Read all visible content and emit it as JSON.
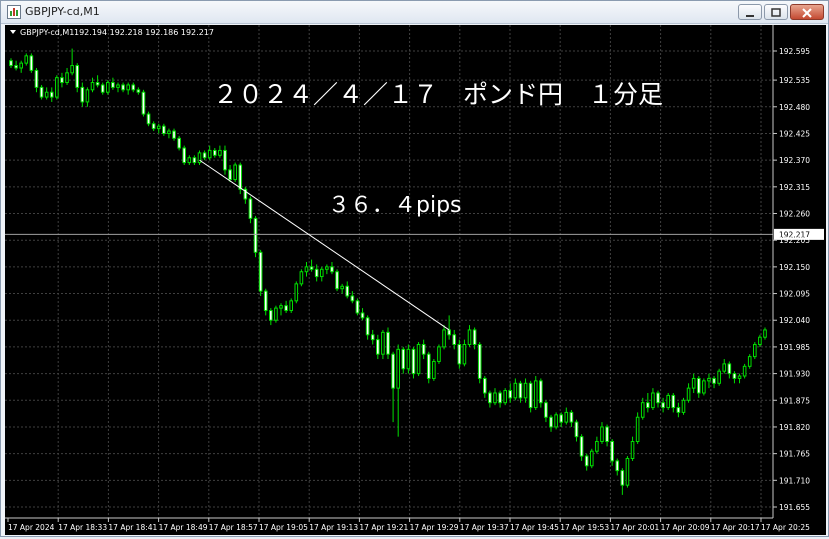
{
  "window": {
    "title": "GBPJPY-cd,M1",
    "buttons": [
      "minimize",
      "maximize",
      "close"
    ]
  },
  "chart_header": {
    "symbol": "GBPJPY-cd,M1",
    "ohlc": "192.194 192.218 192.186 192.217"
  },
  "annotations": {
    "title": "２０２４／４／１７　ポンド円　１分足",
    "pips": "３６．４pips"
  },
  "colors": {
    "background": "#000000",
    "grid": "#404040",
    "candle": "#00e000",
    "text": "#ffffff",
    "trendline": "#ffffff"
  },
  "chart_data": {
    "type": "candlestick",
    "symbol": "GBPJPY-cd",
    "timeframe": "M1",
    "y_ticks": [
      "192.595",
      "192.535",
      "192.480",
      "192.425",
      "192.370",
      "192.315",
      "192.260",
      "192.205",
      "192.150",
      "192.095",
      "192.040",
      "191.985",
      "191.930",
      "191.875",
      "191.820",
      "191.765",
      "191.710",
      "191.655"
    ],
    "x_ticks": [
      "17 Apr 2024",
      "17 Apr 18:33",
      "17 Apr 18:41",
      "17 Apr 18:49",
      "17 Apr 18:57",
      "17 Apr 19:05",
      "17 Apr 19:13",
      "17 Apr 19:21",
      "17 Apr 19:29",
      "17 Apr 19:37",
      "17 Apr 19:45",
      "17 Apr 19:53",
      "17 Apr 20:01",
      "17 Apr 20:09",
      "17 Apr 20:17",
      "17 Apr 20:25"
    ],
    "ylim": [
      191.64,
      192.64
    ],
    "current_price": "192.217",
    "trendline": {
      "from": [
        37,
        192.37
      ],
      "to": [
        86,
        192.02
      ]
    },
    "candles": [
      [
        192.575,
        192.58,
        192.56,
        192.565
      ],
      [
        192.565,
        192.575,
        192.555,
        192.56
      ],
      [
        192.56,
        192.575,
        192.55,
        192.57
      ],
      [
        192.57,
        192.59,
        192.565,
        192.585
      ],
      [
        192.585,
        192.59,
        192.55,
        192.555
      ],
      [
        192.555,
        192.56,
        192.51,
        192.52
      ],
      [
        192.52,
        192.525,
        192.495,
        192.5
      ],
      [
        192.5,
        192.52,
        192.495,
        192.51
      ],
      [
        192.51,
        192.52,
        192.49,
        192.5
      ],
      [
        192.5,
        192.545,
        192.495,
        192.54
      ],
      [
        192.54,
        192.55,
        192.52,
        192.53
      ],
      [
        192.53,
        192.56,
        192.525,
        192.55
      ],
      [
        192.55,
        192.6,
        192.545,
        192.565
      ],
      [
        192.565,
        192.57,
        192.51,
        192.52
      ],
      [
        192.52,
        192.53,
        192.48,
        192.49
      ],
      [
        192.49,
        192.52,
        192.48,
        192.515
      ],
      [
        192.515,
        192.54,
        192.51,
        192.53
      ],
      [
        192.53,
        192.545,
        192.52,
        192.525
      ],
      [
        192.525,
        192.53,
        192.505,
        192.51
      ],
      [
        192.51,
        192.535,
        192.505,
        192.53
      ],
      [
        192.53,
        192.54,
        192.515,
        192.52
      ],
      [
        192.52,
        192.53,
        192.51,
        192.525
      ],
      [
        192.525,
        192.53,
        192.51,
        192.515
      ],
      [
        192.515,
        192.53,
        192.505,
        192.525
      ],
      [
        192.525,
        192.53,
        192.51,
        192.515
      ],
      [
        192.515,
        192.52,
        192.505,
        192.51
      ],
      [
        192.51,
        192.515,
        192.46,
        192.465
      ],
      [
        192.465,
        192.47,
        192.44,
        192.445
      ],
      [
        192.445,
        192.45,
        192.43,
        192.435
      ],
      [
        192.435,
        192.445,
        192.425,
        192.44
      ],
      [
        192.44,
        192.445,
        192.42,
        192.425
      ],
      [
        192.425,
        192.435,
        192.415,
        192.43
      ],
      [
        192.43,
        192.435,
        192.41,
        192.415
      ],
      [
        192.415,
        192.42,
        192.39,
        192.395
      ],
      [
        192.395,
        192.4,
        192.36,
        192.365
      ],
      [
        192.365,
        192.38,
        192.36,
        192.375
      ],
      [
        192.375,
        192.38,
        192.36,
        192.365
      ],
      [
        192.365,
        192.39,
        192.36,
        192.385
      ],
      [
        192.385,
        192.39,
        192.37,
        192.375
      ],
      [
        192.375,
        192.4,
        192.37,
        192.39
      ],
      [
        192.39,
        192.395,
        192.375,
        192.38
      ],
      [
        192.38,
        192.4,
        192.375,
        192.39
      ],
      [
        192.39,
        192.4,
        192.34,
        192.35
      ],
      [
        192.35,
        192.36,
        192.325,
        192.33
      ],
      [
        192.33,
        192.365,
        192.325,
        192.36
      ],
      [
        192.36,
        192.365,
        192.3,
        192.31
      ],
      [
        192.31,
        192.315,
        192.28,
        192.29
      ],
      [
        192.29,
        192.295,
        192.24,
        192.25
      ],
      [
        192.25,
        192.255,
        192.17,
        192.18
      ],
      [
        192.18,
        192.185,
        192.09,
        192.1
      ],
      [
        192.1,
        192.105,
        192.05,
        192.06
      ],
      [
        192.06,
        192.065,
        192.03,
        192.04
      ],
      [
        192.04,
        192.07,
        192.035,
        192.065
      ],
      [
        192.065,
        192.075,
        192.05,
        192.07
      ],
      [
        192.07,
        192.08,
        192.055,
        192.06
      ],
      [
        192.06,
        192.085,
        192.055,
        192.08
      ],
      [
        192.08,
        192.12,
        192.075,
        192.115
      ],
      [
        192.115,
        192.145,
        192.11,
        192.14
      ],
      [
        192.14,
        192.16,
        192.13,
        192.15
      ],
      [
        192.15,
        192.165,
        192.14,
        192.145
      ],
      [
        192.145,
        192.155,
        192.12,
        192.13
      ],
      [
        192.13,
        192.15,
        192.12,
        192.145
      ],
      [
        192.145,
        192.155,
        192.135,
        192.15
      ],
      [
        192.15,
        192.16,
        192.135,
        192.14
      ],
      [
        192.14,
        192.145,
        192.1,
        192.105
      ],
      [
        192.105,
        192.115,
        192.095,
        192.11
      ],
      [
        192.11,
        192.12,
        192.085,
        192.09
      ],
      [
        192.09,
        192.1,
        192.075,
        192.08
      ],
      [
        192.08,
        192.085,
        192.05,
        192.055
      ],
      [
        192.055,
        192.065,
        192.04,
        192.045
      ],
      [
        192.045,
        192.05,
        192.0,
        192.01
      ],
      [
        192.01,
        192.02,
        191.99,
        192.0
      ],
      [
        192.0,
        192.01,
        191.96,
        191.97
      ],
      [
        191.97,
        192.02,
        191.96,
        192.015
      ],
      [
        192.015,
        192.025,
        191.96,
        191.97
      ],
      [
        191.97,
        191.975,
        191.83,
        191.9
      ],
      [
        191.9,
        191.99,
        191.8,
        191.98
      ],
      [
        191.98,
        191.985,
        191.93,
        191.94
      ],
      [
        191.94,
        191.99,
        191.93,
        191.98
      ],
      [
        191.98,
        191.985,
        191.92,
        191.93
      ],
      [
        191.93,
        191.995,
        191.925,
        191.99
      ],
      [
        191.99,
        192.0,
        191.96,
        191.97
      ],
      [
        191.97,
        191.975,
        191.91,
        191.92
      ],
      [
        191.92,
        191.96,
        191.915,
        191.955
      ],
      [
        191.955,
        191.99,
        191.95,
        191.985
      ],
      [
        191.985,
        192.03,
        191.98,
        192.02
      ],
      [
        192.02,
        192.05,
        192.0,
        192.01
      ],
      [
        192.01,
        192.02,
        191.98,
        191.99
      ],
      [
        191.99,
        192.0,
        191.94,
        191.95
      ],
      [
        191.95,
        192.0,
        191.945,
        191.99
      ],
      [
        191.99,
        192.03,
        191.985,
        192.02
      ],
      [
        192.02,
        192.025,
        191.98,
        191.99
      ],
      [
        191.99,
        191.995,
        191.91,
        191.92
      ],
      [
        191.92,
        191.925,
        191.88,
        191.89
      ],
      [
        191.89,
        191.895,
        191.86,
        191.87
      ],
      [
        191.87,
        191.9,
        191.865,
        191.89
      ],
      [
        191.89,
        191.895,
        191.86,
        191.87
      ],
      [
        191.87,
        191.9,
        191.865,
        191.895
      ],
      [
        191.895,
        191.91,
        191.87,
        191.88
      ],
      [
        191.88,
        191.92,
        191.875,
        191.91
      ],
      [
        191.91,
        191.915,
        191.87,
        191.88
      ],
      [
        191.88,
        191.92,
        191.87,
        191.91
      ],
      [
        191.91,
        191.915,
        191.85,
        191.86
      ],
      [
        191.86,
        191.925,
        191.855,
        191.915
      ],
      [
        191.915,
        191.92,
        191.86,
        191.87
      ],
      [
        191.87,
        191.875,
        191.83,
        191.84
      ],
      [
        191.84,
        191.845,
        191.81,
        191.82
      ],
      [
        191.82,
        191.85,
        191.815,
        191.845
      ],
      [
        191.845,
        191.85,
        191.82,
        191.83
      ],
      [
        191.83,
        191.86,
        191.825,
        191.85
      ],
      [
        191.85,
        191.855,
        191.82,
        191.83
      ],
      [
        191.83,
        191.835,
        191.79,
        191.8
      ],
      [
        191.8,
        191.805,
        191.75,
        191.76
      ],
      [
        191.76,
        191.765,
        191.73,
        191.74
      ],
      [
        191.74,
        191.775,
        191.735,
        191.77
      ],
      [
        191.77,
        191.8,
        191.765,
        191.79
      ],
      [
        191.79,
        191.83,
        191.785,
        191.82
      ],
      [
        191.82,
        191.825,
        191.78,
        191.79
      ],
      [
        191.79,
        191.795,
        191.74,
        191.75
      ],
      [
        191.75,
        191.755,
        191.72,
        191.73
      ],
      [
        191.73,
        191.735,
        191.68,
        191.7
      ],
      [
        191.7,
        191.76,
        191.695,
        191.755
      ],
      [
        191.755,
        191.8,
        191.75,
        191.79
      ],
      [
        191.79,
        191.85,
        191.785,
        191.84
      ],
      [
        191.84,
        191.88,
        191.835,
        191.87
      ],
      [
        191.87,
        191.89,
        191.85,
        191.86
      ],
      [
        191.86,
        191.9,
        191.855,
        191.89
      ],
      [
        191.89,
        191.895,
        191.86,
        191.87
      ],
      [
        191.87,
        191.88,
        191.85,
        191.86
      ],
      [
        191.86,
        191.89,
        191.855,
        191.885
      ],
      [
        191.885,
        191.89,
        191.85,
        191.86
      ],
      [
        191.86,
        191.87,
        191.84,
        191.85
      ],
      [
        191.85,
        191.88,
        191.845,
        191.875
      ],
      [
        191.875,
        191.91,
        191.87,
        191.9
      ],
      [
        191.9,
        191.93,
        191.89,
        191.92
      ],
      [
        191.92,
        191.925,
        191.88,
        191.89
      ],
      [
        191.89,
        191.92,
        191.885,
        191.915
      ],
      [
        191.915,
        191.93,
        191.9,
        191.92
      ],
      [
        191.92,
        191.925,
        191.9,
        191.91
      ],
      [
        191.91,
        191.94,
        191.905,
        191.935
      ],
      [
        191.935,
        191.96,
        191.93,
        191.95
      ],
      [
        191.95,
        191.955,
        191.92,
        191.93
      ],
      [
        191.93,
        191.935,
        191.91,
        191.92
      ],
      [
        191.92,
        191.93,
        191.91,
        191.925
      ],
      [
        191.925,
        191.95,
        191.92,
        191.945
      ],
      [
        191.945,
        191.97,
        191.94,
        191.965
      ],
      [
        191.965,
        191.995,
        191.96,
        191.99
      ],
      [
        191.99,
        192.01,
        191.985,
        192.005
      ],
      [
        192.005,
        192.025,
        192.0,
        192.02
      ]
    ]
  }
}
